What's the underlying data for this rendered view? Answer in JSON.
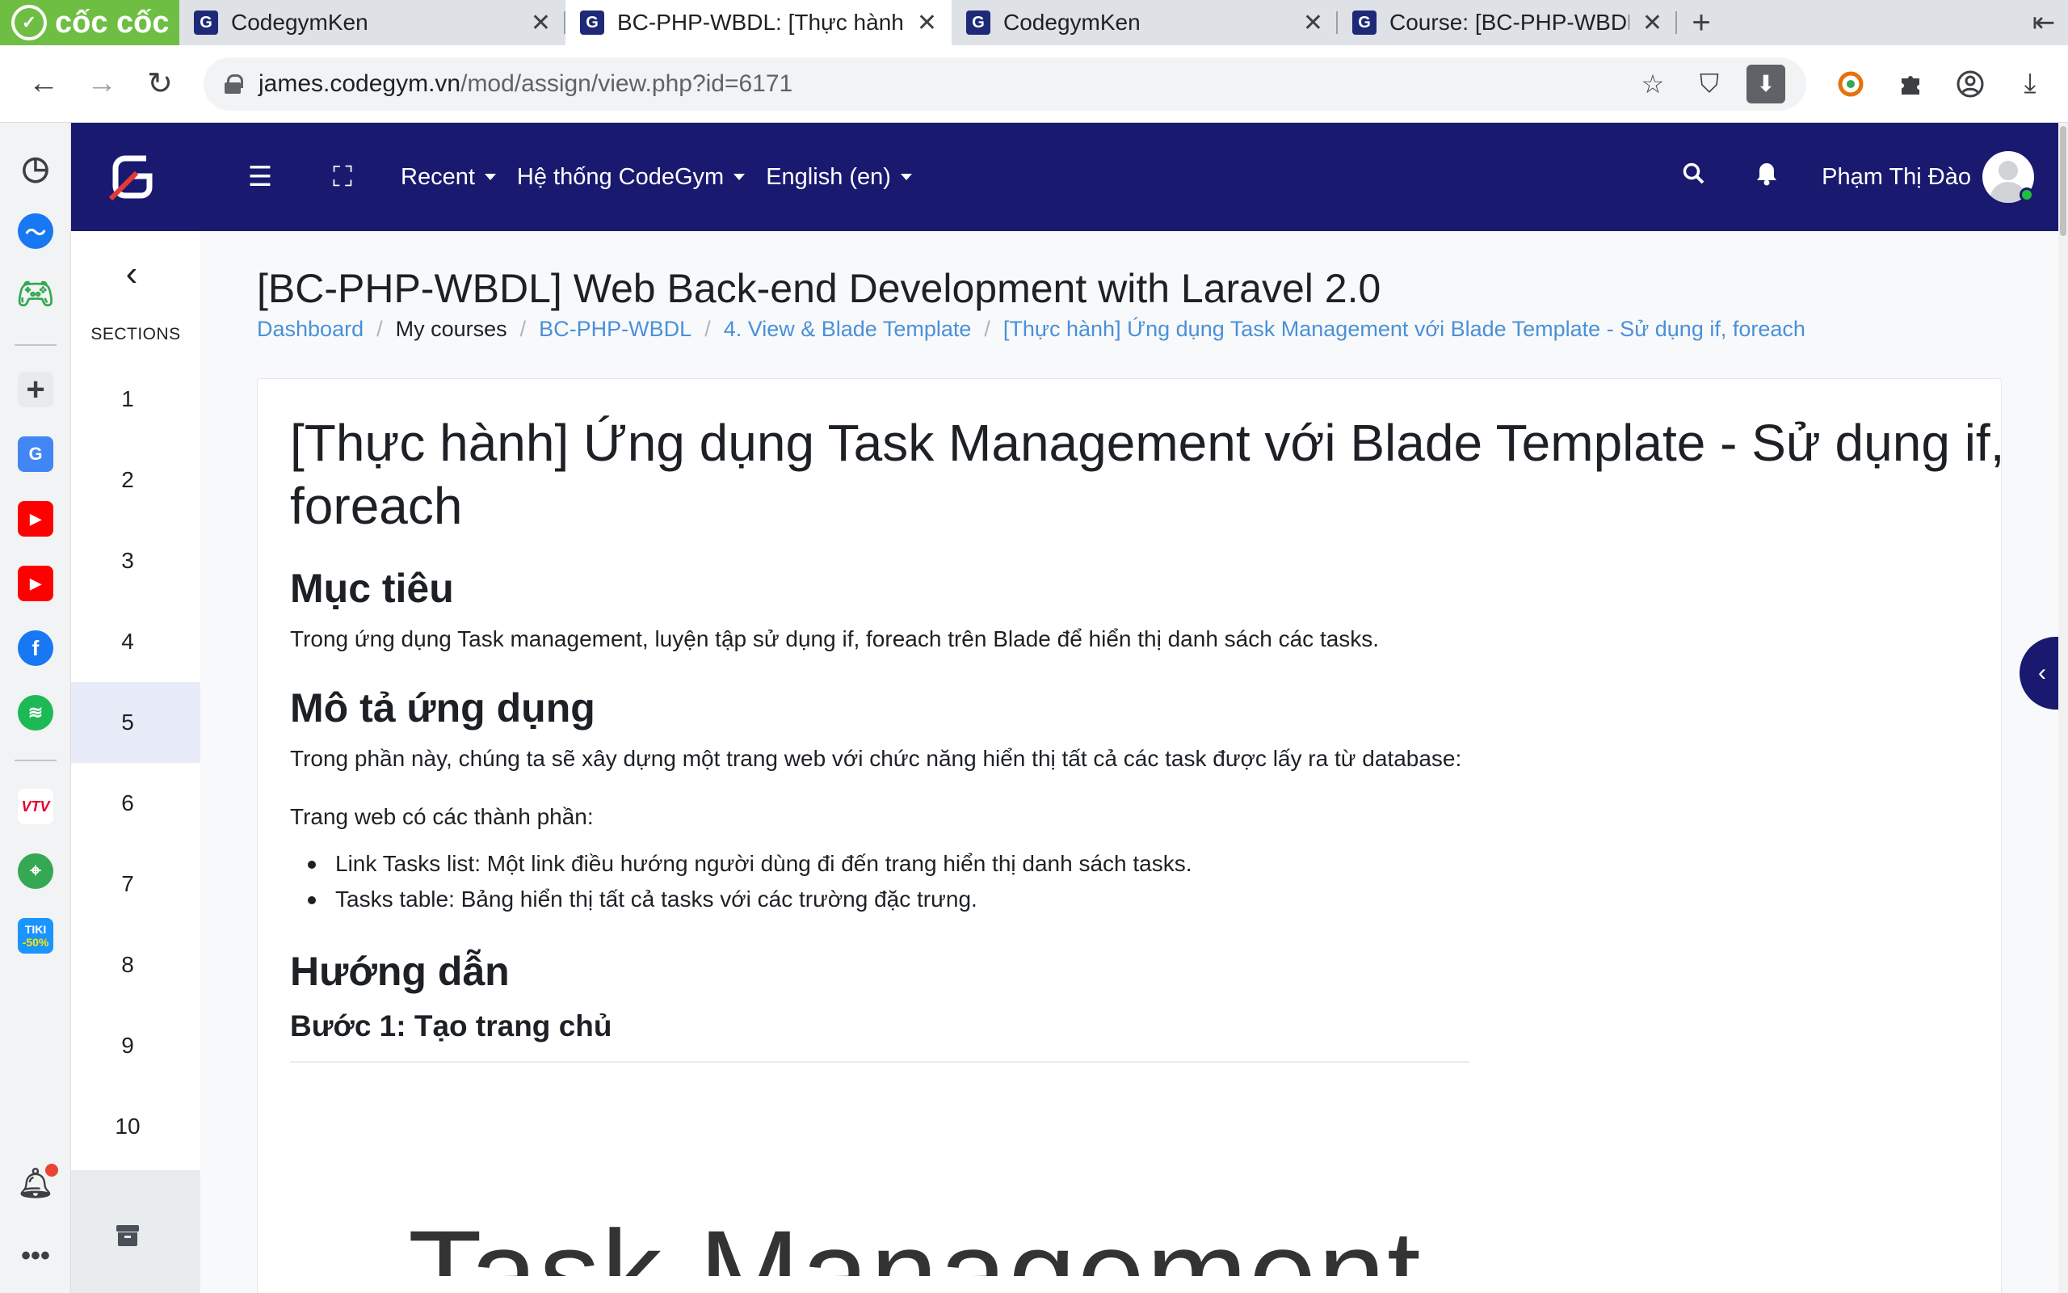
{
  "browser": {
    "brand_name": "cốc cốc",
    "tabs": [
      {
        "title": "CodegymKen",
        "active": false
      },
      {
        "title": "BC-PHP-WBDL: [Thực hành] Ứng",
        "active": true
      },
      {
        "title": "CodegymKen",
        "active": false
      },
      {
        "title": "Course: [BC-PHP-WBDL] Web",
        "active": false
      }
    ],
    "new_tab_symbol": "+",
    "url_host": "james.codegym.vn",
    "url_path": "/mod/assign/view.php?id=6171",
    "icons": [
      "back-icon",
      "forward-icon",
      "reload-icon",
      "lock-icon",
      "star-icon",
      "shield-icon",
      "download-box-icon",
      "coccoc-extension-icon",
      "puzzle-icon",
      "profile-icon",
      "download-icon"
    ]
  },
  "dock": {
    "icons": [
      "history-icon",
      "messenger-icon",
      "game-icon",
      "add-icon",
      "translate-icon",
      "youtube-icon",
      "youtube-icon",
      "facebook-icon",
      "spotify-icon",
      "vtv-go-icon",
      "maps-icon",
      "tiki-icon",
      "bell-icon",
      "more-icon"
    ],
    "tiki_label": "TIKI",
    "tiki_badge": "-50%",
    "vtv_label": "VTV"
  },
  "app": {
    "nav": {
      "recent": "Recent",
      "system": "Hệ thống CodeGym",
      "language": "English (en)",
      "username": "Phạm Thị Đào"
    },
    "drawer": {
      "sections_label": "SECTIONS",
      "sections": [
        "1",
        "2",
        "3",
        "4",
        "5",
        "6",
        "7",
        "8",
        "9",
        "10"
      ],
      "active_section": "5"
    },
    "course_title": "[BC-PHP-WBDL] Web Back-end Development with Laravel 2.0",
    "breadcrumb": [
      {
        "label": "Dashboard",
        "link": true
      },
      {
        "label": "My courses",
        "link": false
      },
      {
        "label": "BC-PHP-WBDL",
        "link": true
      },
      {
        "label": "4. View & Blade Template",
        "link": true
      },
      {
        "label": "[Thực hành] Ứng dụng Task Management với Blade Template - Sử dụng if, foreach",
        "link": true
      }
    ],
    "content": {
      "title_line1": "[Thực hành] Ứng dụng Task Management với Blade Template - Sử dụng if,",
      "title_line2": "foreach",
      "h_goal": "Mục tiêu",
      "p_goal": "Trong ứng dụng Task management, luyện tập sử dụng if, foreach trên Blade để hiển thị danh sách các tasks.",
      "h_desc": "Mô tả ứng dụng",
      "p_desc": "Trong phần này, chúng ta sẽ xây dựng một trang web với chức năng hiển thị tất cả các task được lấy ra từ database:",
      "p_parts": "Trang web có các thành phần:",
      "bullets": [
        "Link Tasks list: Một link điều hướng người dùng đi đến trang hiển thị danh sách tasks.",
        "Tasks table: Bảng hiển thị tất cả tasks với các trường đặc trưng."
      ],
      "h_guide": "Hướng dẫn",
      "h_step1": "Bước 1: Tạo trang chủ",
      "figure_text": "Task Management"
    },
    "colors": {
      "navbar": "#1a1970",
      "link": "#4a90d9",
      "active_section_bg": "#e7ecf8",
      "brand_green": "#6fbe44"
    }
  }
}
